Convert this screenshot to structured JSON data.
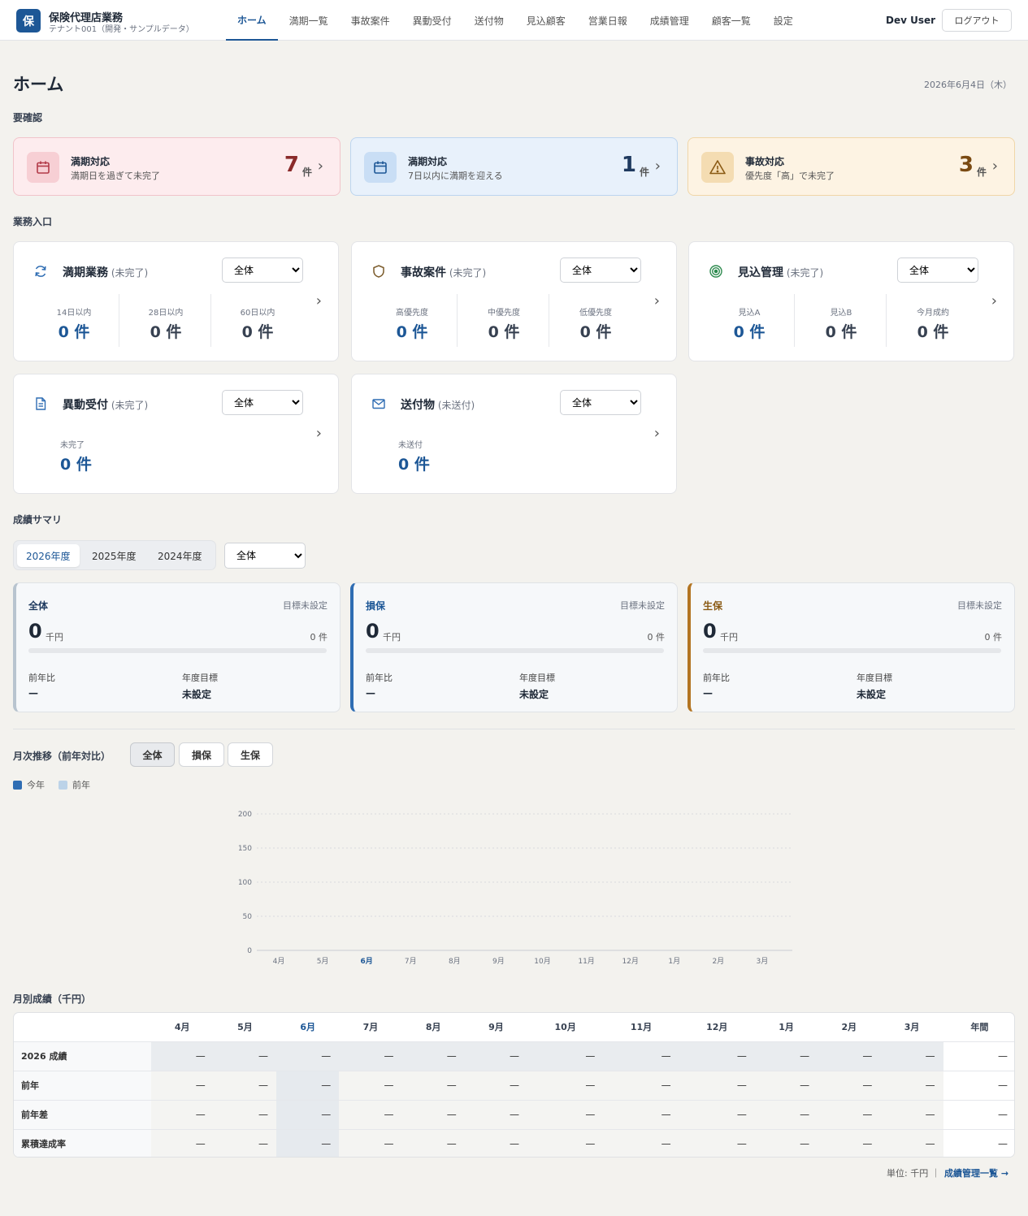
{
  "header": {
    "logo_char": "保",
    "app_title": "保険代理店業務",
    "tenant": "テナント001（開発・サンプルデータ）",
    "nav": [
      "ホーム",
      "満期一覧",
      "事故案件",
      "異動受付",
      "送付物",
      "見込顧客",
      "営業日報",
      "成績管理",
      "顧客一覧",
      "設定"
    ],
    "active_nav": "ホーム",
    "user": "Dev User",
    "logout": "ログアウト"
  },
  "page": {
    "title": "ホーム",
    "date": "2026年6月4日（木）"
  },
  "attention": {
    "label": "要確認",
    "cards": [
      {
        "title": "満期対応",
        "desc": "満期日を過ぎて未完了",
        "count": "7",
        "unit": "件",
        "icon": "calendar-icon",
        "color": "#8a2a2a"
      },
      {
        "title": "満期対応",
        "desc": "7日以内に満期を迎える",
        "count": "1",
        "unit": "件",
        "icon": "calendar-icon",
        "color": "#1f3a5f"
      },
      {
        "title": "事故対応",
        "desc": "優先度「高」で未完了",
        "count": "3",
        "unit": "件",
        "icon": "warning-icon",
        "color": "#7a4a12"
      }
    ]
  },
  "entry": {
    "label": "業務入口",
    "cards": [
      {
        "title": "満期業務",
        "sub": "(未完了)",
        "filter": "全体",
        "icon": "refresh-icon",
        "metrics": [
          {
            "label": "14日以内",
            "value": "0 件"
          },
          {
            "label": "28日以内",
            "value": "0 件"
          },
          {
            "label": "60日以内",
            "value": "0 件"
          }
        ]
      },
      {
        "title": "事故案件",
        "sub": "(未完了)",
        "filter": "全体",
        "icon": "shield-icon",
        "metrics": [
          {
            "label": "高優先度",
            "value": "0 件"
          },
          {
            "label": "中優先度",
            "value": "0 件"
          },
          {
            "label": "低優先度",
            "value": "0 件"
          }
        ]
      },
      {
        "title": "見込管理",
        "sub": "(未完了)",
        "filter": "全体",
        "icon": "target-icon",
        "metrics": [
          {
            "label": "見込A",
            "value": "0 件"
          },
          {
            "label": "見込B",
            "value": "0 件"
          },
          {
            "label": "今月成約",
            "value": "0 件"
          }
        ]
      },
      {
        "title": "異動受付",
        "sub": "(未完了)",
        "filter": "全体",
        "icon": "document-icon",
        "metrics": [
          {
            "label": "未完了",
            "value": "0 件"
          }
        ]
      },
      {
        "title": "送付物",
        "sub": "(未送付)",
        "filter": "全体",
        "icon": "mail-icon",
        "metrics": [
          {
            "label": "未送付",
            "value": "0 件"
          }
        ]
      }
    ]
  },
  "summary": {
    "label": "成績サマリ",
    "years": [
      "2026年度",
      "2025年度",
      "2024年度"
    ],
    "active_year": "2026年度",
    "filter": "全体",
    "cards": [
      {
        "name": "全体",
        "target_status": "目標未設定",
        "value": "0",
        "unit": "千円",
        "count": "0 件",
        "progress": 0,
        "yoy_label": "前年比",
        "yoy": "—",
        "goal_label": "年度目標",
        "goal": "未設定",
        "accent": "#b8c4cf",
        "name_color": "#1f3a5f"
      },
      {
        "name": "損保",
        "target_status": "目標未設定",
        "value": "0",
        "unit": "千円",
        "count": "0 件",
        "progress": 0,
        "yoy_label": "前年比",
        "yoy": "—",
        "goal_label": "年度目標",
        "goal": "未設定",
        "accent": "#2f6db3",
        "name_color": "#1d5796"
      },
      {
        "name": "生保",
        "target_status": "目標未設定",
        "value": "0",
        "unit": "千円",
        "count": "0 件",
        "progress": 0,
        "yoy_label": "前年比",
        "yoy": "—",
        "goal_label": "年度目標",
        "goal": "未設定",
        "accent": "#b37421",
        "name_color": "#8a5a14"
      }
    ]
  },
  "monthly": {
    "label": "月次推移（前年対比）",
    "buttons": [
      "全体",
      "損保",
      "生保"
    ],
    "active_button": "全体",
    "legend": [
      {
        "name": "今年",
        "color": "#2f6db3"
      },
      {
        "name": "前年",
        "color": "#bcd3e8"
      }
    ]
  },
  "chart_data": {
    "type": "bar",
    "categories": [
      "4月",
      "5月",
      "6月",
      "7月",
      "8月",
      "9月",
      "10月",
      "11月",
      "12月",
      "1月",
      "2月",
      "3月"
    ],
    "highlight_category": "6月",
    "series": [
      {
        "name": "今年",
        "values": [
          0,
          0,
          0,
          0,
          0,
          0,
          0,
          0,
          0,
          0,
          0,
          0
        ]
      },
      {
        "name": "前年",
        "values": [
          0,
          0,
          0,
          0,
          0,
          0,
          0,
          0,
          0,
          0,
          0,
          0
        ]
      }
    ],
    "yticks": [
      "200",
      "150",
      "100",
      "50",
      "0"
    ],
    "ylim": [
      0,
      200
    ],
    "grid": true
  },
  "table": {
    "label": "月別成績（千円）",
    "columns": [
      "4月",
      "5月",
      "6月",
      "7月",
      "8月",
      "9月",
      "10月",
      "11月",
      "12月",
      "1月",
      "2月",
      "3月",
      "年間"
    ],
    "rows": [
      {
        "label": "2026 成績",
        "values": [
          "—",
          "—",
          "—",
          "—",
          "—",
          "—",
          "—",
          "—",
          "—",
          "—",
          "—",
          "—",
          "—"
        ]
      },
      {
        "label": "前年",
        "values": [
          "—",
          "—",
          "—",
          "—",
          "—",
          "—",
          "—",
          "—",
          "—",
          "—",
          "—",
          "—",
          "—"
        ]
      },
      {
        "label": "前年差",
        "values": [
          "—",
          "—",
          "—",
          "—",
          "—",
          "—",
          "—",
          "—",
          "—",
          "—",
          "—",
          "—",
          "—"
        ]
      },
      {
        "label": "累積達成率",
        "values": [
          "—",
          "—",
          "—",
          "—",
          "—",
          "—",
          "—",
          "—",
          "—",
          "—",
          "—",
          "—",
          "—"
        ]
      }
    ],
    "unit_note": "単位: 千円 ｜",
    "link": "成績管理一覧 →"
  }
}
